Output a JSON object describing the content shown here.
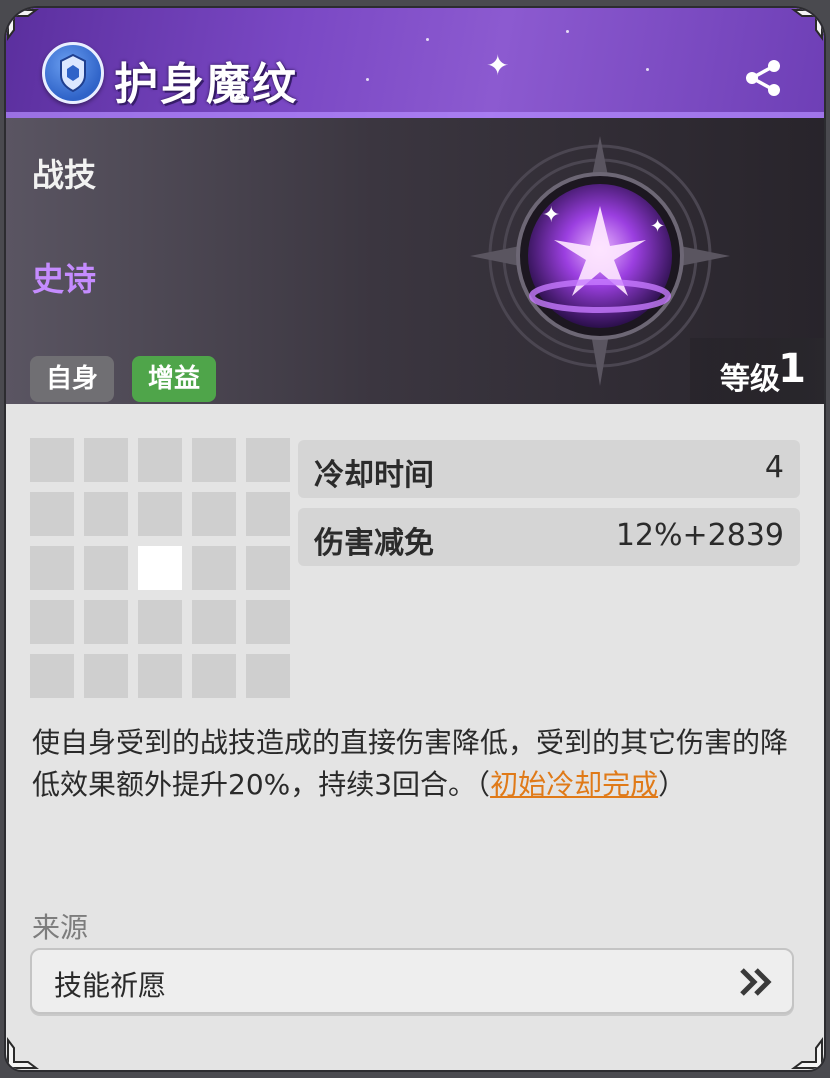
{
  "skill": {
    "title": "护身魔纹",
    "type": "战技",
    "rarity": "史诗",
    "tags": [
      "自身",
      "增益"
    ],
    "level_label": "等级",
    "level_value": "1"
  },
  "stats": [
    {
      "name": "冷却时间",
      "value": "4"
    },
    {
      "name": "伤害减免",
      "value": "12%+2839"
    }
  ],
  "range_grid": {
    "rows": 5,
    "cols": 5,
    "active_cell": [
      2,
      2
    ]
  },
  "description": {
    "text": "使自身受到的战技造成的直接伤害降低，受到的其它伤害的降低效果额外提升20%，持续3回合。（",
    "highlight": "初始冷却完成",
    "suffix": "）"
  },
  "source": {
    "label": "来源",
    "item": "技能祈愿"
  },
  "icons": {
    "header_badge": "shield-emblem-icon",
    "share": "share-icon",
    "skill_art": "purple-orb-icon",
    "source_arrow": "double-chevron-right-icon"
  },
  "colors": {
    "rarity": "#c58cff",
    "buff_tag": "#4fa54a",
    "self_tag": "#706f73",
    "highlight": "#e07a18",
    "header": "#7a48c4"
  }
}
